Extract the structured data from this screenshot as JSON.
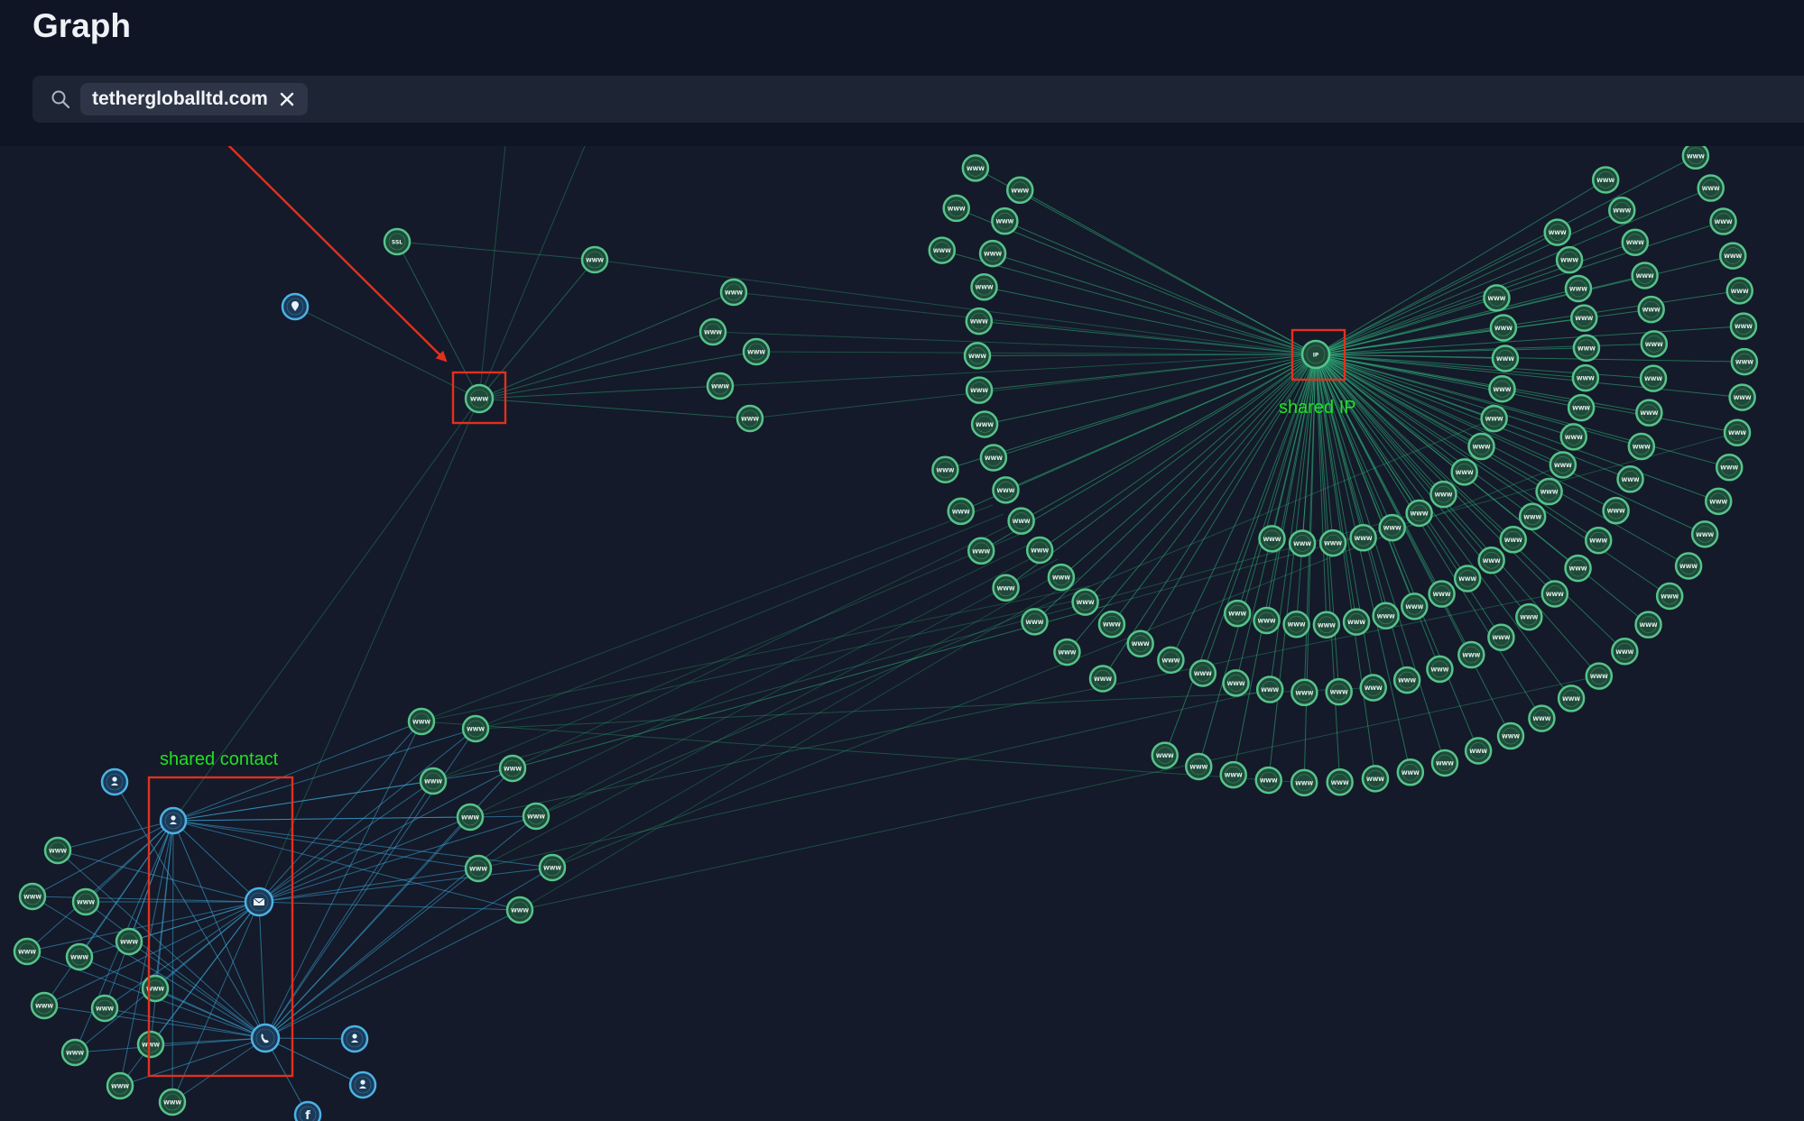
{
  "header": {
    "title": "Graph"
  },
  "search": {
    "chip_label": "tethergloballtd.com"
  },
  "annotations": {
    "shared_ip": "shared IP",
    "shared_contact": "shared contact"
  },
  "nodes": {
    "ssl_label": "SSL",
    "www_label": "WWW",
    "ip_label": "IP"
  },
  "colors": {
    "background": "#141a29",
    "header": "#0f1524",
    "node_green": "#55c48a",
    "node_fill": "#1f4a3a",
    "edge_green": "#2fb27c",
    "edge_blue": "#3aa6d8",
    "node_blue": "#4bb2e6",
    "annotation_red": "#e2301f",
    "annotation_text": "#22e022"
  },
  "icons": {
    "search": "search-icon",
    "remove_chip": "close-icon",
    "location": "location-pin-icon",
    "person": "person-icon",
    "email": "envelope-icon",
    "phone": "phone-icon",
    "facebook": "facebook-icon"
  }
}
